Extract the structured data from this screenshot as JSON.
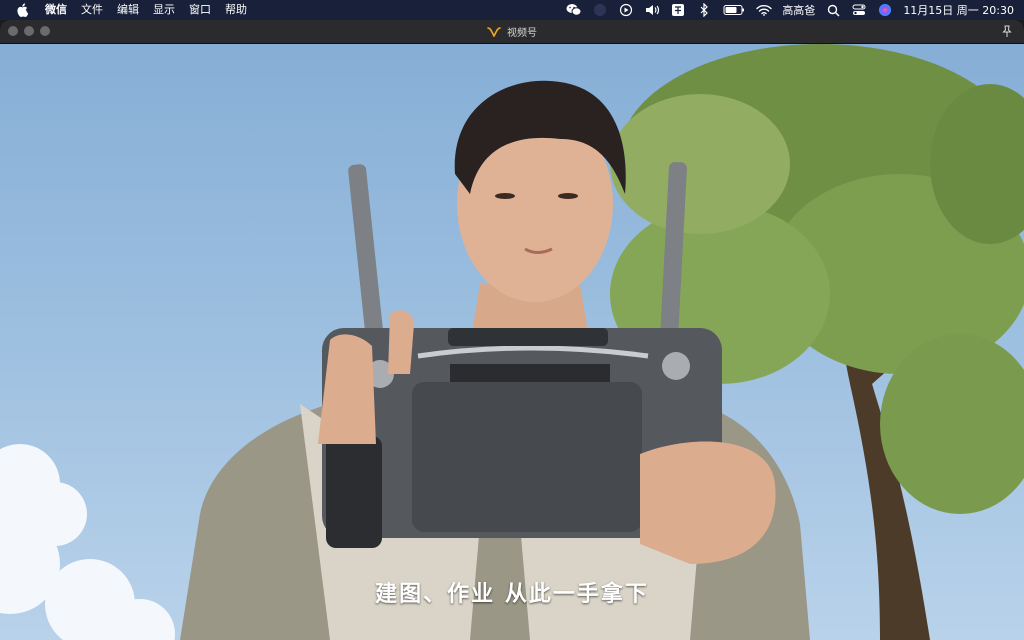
{
  "menubar": {
    "app_name": "微信",
    "menus": [
      "文件",
      "编辑",
      "显示",
      "窗口",
      "帮助"
    ],
    "user_name": "高高爸",
    "datetime": "11月15日 周一  20:30",
    "icons": [
      "apple-icon",
      "wechat-icon",
      "record-icon",
      "play-icon",
      "volume-icon",
      "input-method-icon",
      "bluetooth-icon",
      "battery-icon",
      "wifi-icon",
      "search-icon",
      "control-center-icon",
      "siri-icon"
    ]
  },
  "window": {
    "title": "视频号",
    "title_icon": "channels-icon"
  },
  "video": {
    "subtitle": "建图、作业 从此一手拿下"
  },
  "colors": {
    "menubar_bg": "#18203a",
    "titlebar_bg": "#2b2b2e",
    "channels_accent": "#f5a623"
  }
}
